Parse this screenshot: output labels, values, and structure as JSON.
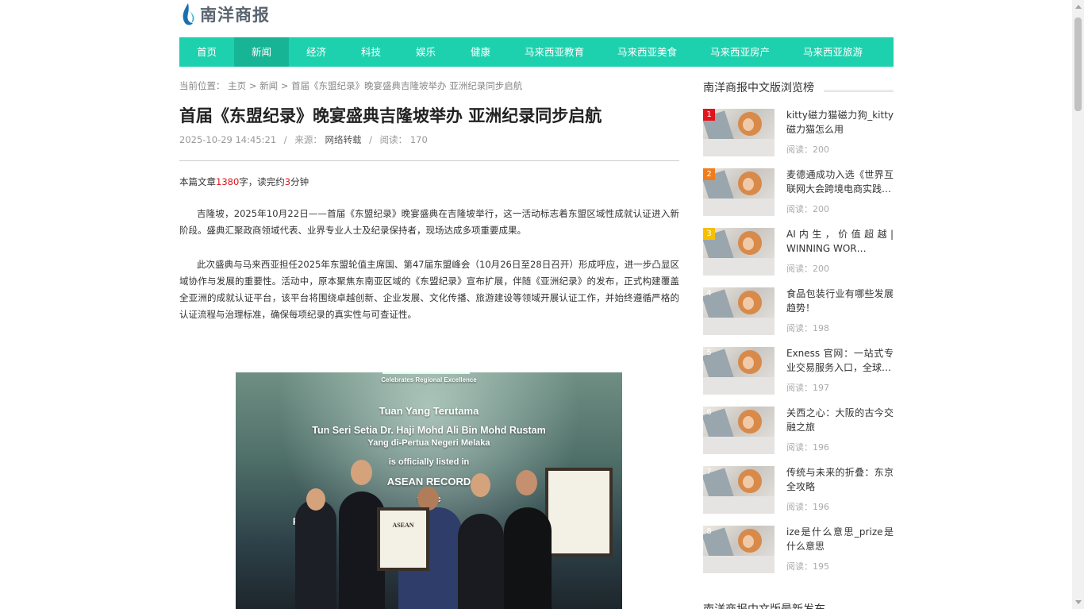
{
  "brand": {
    "name": "南洋商报"
  },
  "nav": {
    "items": [
      "首页",
      "新闻",
      "经济",
      "科技",
      "娱乐",
      "健康",
      "马来西亚教育",
      "马来西亚美食",
      "马来西亚房产",
      "马来西亚旅游"
    ],
    "active_index": 1
  },
  "breadcrumb": {
    "prefix": "当前位置：",
    "home": "主页",
    "sep": ">",
    "section": "新闻",
    "current": "首届《东盟纪录》晚宴盛典吉隆坡举办 亚洲纪录同步启航"
  },
  "article": {
    "title": "首届《东盟纪录》晚宴盛典吉隆坡举办 亚洲纪录同步启航",
    "datetime": "2025-10-29 14:45:21",
    "source_label": "来源：",
    "source": "网络转载",
    "views_label": "阅读：",
    "views": "170",
    "readtime_a": "本篇文章",
    "readtime_chars": "1380",
    "readtime_b": "字，读完约",
    "readtime_min": "3",
    "readtime_c": "分钟",
    "para1": "吉隆坡，2025年10月22日——首届《东盟纪录》晚宴盛典在吉隆坡举行，这一活动标志着东盟区域性成就认证进入新阶段。盛典汇聚政商领域代表、业界专业人士及纪录保持者，现场达成多项重要成果。",
    "para2": "此次盛典与马来西亚担任2025年东盟轮值主席国、第47届东盟峰会（10月26日至28日召开）形成呼应，进一步凸显区域协作与发展的重要性。活动中，原本聚焦东南亚区域的《东盟纪录》宣布扩展，伴随《亚洲纪录》的发布，正式构建覆盖全亚洲的成就认证平台，该平台将围绕卓越创新、企业发展、文化传播、旅游建设等领域开展认证工作，并始终遵循严格的认证流程与治理标准，确保每项纪录的真实性与可查证性。"
  },
  "photo": {
    "line1": "Celebrates Regional Excellence",
    "line2": "Tuan Yang Terutama",
    "line3": "Tun Seri Setia Dr. Haji Mohd Ali Bin Mohd Rustam",
    "line4": "Yang di-Pertua Negeri Melaka",
    "line5": "is officially listed in",
    "line6": "ASEAN RECORD",
    "line7": "for ac",
    "line8": "First an",
    "plaque": "ASEAN"
  },
  "sidebar": {
    "heading": "南洋商报中文版浏览榜",
    "read_label": "阅读：",
    "items": [
      {
        "rank": "1",
        "title": "kitty磁力猫磁力狗_kitty磁力猫怎么用",
        "views": "200"
      },
      {
        "rank": "2",
        "title": "麦德通成功入选《世界互联网大会跨境电商实践…",
        "views": "200"
      },
      {
        "rank": "3",
        "title": "AI 内 生 ， 价 值 超 越 | WINNING WOR…",
        "views": "200"
      },
      {
        "rank": "4",
        "title": "食品包装行业有哪些发展趋势！",
        "views": "198"
      },
      {
        "rank": "5",
        "title": "Exness 官网：一站式专业交易服务入口，全球…",
        "views": "197"
      },
      {
        "rank": "6",
        "title": "关西之心：大阪的古今交融之旅",
        "views": "196"
      },
      {
        "rank": "7",
        "title": "传统与未来的折叠：东京全攻略",
        "views": "196"
      },
      {
        "rank": "8",
        "title": "ize是什么意思_prize是什么意思",
        "views": "195"
      }
    ],
    "footer_heading": "南洋商报中文版最新发布"
  },
  "colors": {
    "nav_bg": "#1ed1ae",
    "nav_active": "#17b596",
    "accent_red": "#e0151b"
  }
}
